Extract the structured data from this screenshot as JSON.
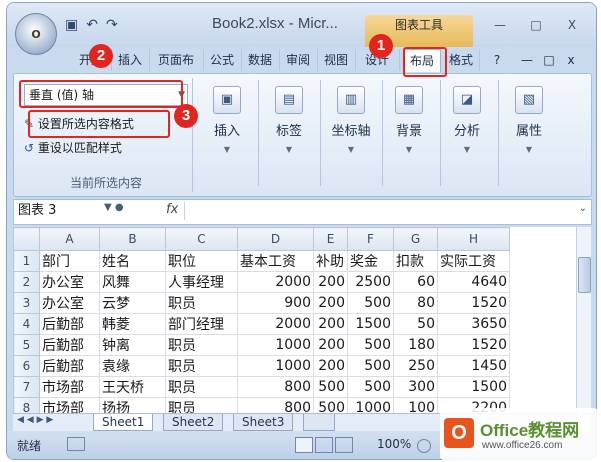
{
  "window": {
    "office_button": "O",
    "qat_save_icon": "save-icon",
    "qat_undo": "↶",
    "qat_redo": "↷",
    "doc_title": "Book2.xlsx - Micr...",
    "tools_title": "图表工具",
    "min_label": "—",
    "max_label": "□",
    "close_label": "X"
  },
  "tabs": {
    "start": "开始",
    "insert": "插入",
    "page_layout": "页面布",
    "formula": "公式",
    "data": "数据",
    "review": "审阅",
    "view": "视图",
    "design": "设计",
    "layout": "布局",
    "format": "格式",
    "help": "?",
    "ribbon_min": "—",
    "ribbon_restore": "□",
    "ribbon_close": "x"
  },
  "ribbon": {
    "selection_combo": "垂直 (值) 轴",
    "format_selection": "设置所选内容格式",
    "reset_style": "重设以匹配样式",
    "group_current_selection": "当前所选内容",
    "buttons": [
      {
        "label": "插入",
        "icon": "insert-icon"
      },
      {
        "label": "标签",
        "icon": "labels-icon"
      },
      {
        "label": "坐标轴",
        "icon": "axes-icon"
      },
      {
        "label": "背景",
        "icon": "background-icon"
      },
      {
        "label": "分析",
        "icon": "analysis-icon"
      },
      {
        "label": "属性",
        "icon": "properties-icon"
      }
    ]
  },
  "badges": [
    "1",
    "2",
    "3"
  ],
  "formula_bar": {
    "name_box": "图表 3",
    "fx": "fx",
    "value": ""
  },
  "grid": {
    "columns": [
      "A",
      "B",
      "C",
      "D",
      "E",
      "F",
      "G",
      "H"
    ],
    "rows": [
      {
        "n": "1",
        "cells": [
          "部门",
          "姓名",
          "职位",
          "基本工资",
          "补助",
          "奖金",
          "扣款",
          "实际工资"
        ]
      },
      {
        "n": "2",
        "cells": [
          "办公室",
          "风舞",
          "人事经理",
          "2000",
          "200",
          "2500",
          "60",
          "4640"
        ]
      },
      {
        "n": "3",
        "cells": [
          "办公室",
          "云梦",
          "职员",
          "900",
          "200",
          "500",
          "80",
          "1520"
        ]
      },
      {
        "n": "4",
        "cells": [
          "后勤部",
          "韩菱",
          "部门经理",
          "2000",
          "200",
          "1500",
          "50",
          "3650"
        ]
      },
      {
        "n": "5",
        "cells": [
          "后勤部",
          "钟离",
          "职员",
          "1000",
          "200",
          "500",
          "180",
          "1520"
        ]
      },
      {
        "n": "6",
        "cells": [
          "后勤部",
          "袁缘",
          "职员",
          "1000",
          "200",
          "500",
          "250",
          "1450"
        ]
      },
      {
        "n": "7",
        "cells": [
          "市场部",
          "王天桥",
          "职员",
          "800",
          "500",
          "500",
          "300",
          "1500"
        ]
      },
      {
        "n": "8",
        "cells": [
          "市场部",
          "扬扬",
          "职员",
          "800",
          "500",
          "1000",
          "100",
          "2200"
        ]
      }
    ]
  },
  "sheets": {
    "nav": "◀ ◀ ▶ ▶",
    "tabs": [
      "Sheet1",
      "Sheet2",
      "Sheet3"
    ]
  },
  "status": {
    "ready": "就绪",
    "zoom": "100%"
  },
  "watermark": {
    "title": "Office教程网",
    "url": "www.office26.com"
  },
  "colors": {
    "highlight_red": "#e0261f",
    "tools_tab": "#e8b957"
  }
}
